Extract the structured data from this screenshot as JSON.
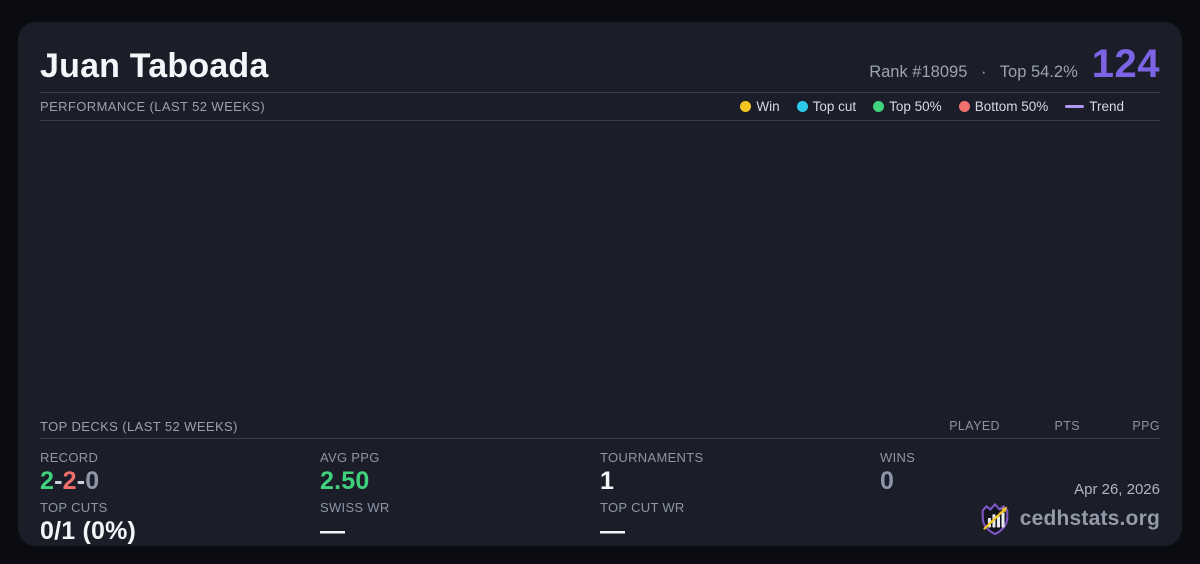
{
  "header": {
    "title": "Juan Taboada",
    "rank_text": "Rank #18095",
    "separator": "·",
    "top_percent_text": "Top 54.2%",
    "points": "124"
  },
  "performance": {
    "label": "PERFORMANCE (LAST 52 WEEKS)",
    "legend": [
      {
        "label": "Win",
        "color": "#f3c622",
        "swatch": "dot"
      },
      {
        "label": "Top cut",
        "color": "#2bc9ea",
        "swatch": "dot"
      },
      {
        "label": "Top 50%",
        "color": "#41d47e",
        "swatch": "dot"
      },
      {
        "label": "Bottom 50%",
        "color": "#f1706d",
        "swatch": "dot"
      },
      {
        "label": "Trend",
        "color": "#b095f2",
        "swatch": "line"
      }
    ]
  },
  "chart_data": {
    "type": "scatter",
    "title": "PERFORMANCE (LAST 52 WEEKS)",
    "series": [],
    "legend_position": "top-right",
    "grid": false
  },
  "top_decks": {
    "label": "TOP DECKS (LAST 52 WEEKS)",
    "columns": [
      "PLAYED",
      "PTS",
      "PPG"
    ],
    "rows": []
  },
  "stats": {
    "record": {
      "label": "RECORD",
      "wins": "2",
      "losses": "2",
      "draws": "0",
      "separator": "-"
    },
    "avg_ppg": {
      "label": "AVG PPG",
      "value": "2.50"
    },
    "tournaments": {
      "label": "TOURNAMENTS",
      "value": "1"
    },
    "wins": {
      "label": "WINS",
      "value": "0"
    },
    "top_cuts": {
      "label": "TOP CUTS",
      "value": "0/1 (0%)"
    },
    "swiss_wr": {
      "label": "SWISS WR",
      "value": "—"
    },
    "top_cut_wr": {
      "label": "TOP CUT WR",
      "value": "—"
    }
  },
  "footer": {
    "date": "Apr 26, 2026",
    "brand": "cedhstats.org",
    "logo_icon": "shield-bar-chart-arrow"
  },
  "colors": {
    "accent_purple": "#7d64e5",
    "trend_purple": "#b095f2",
    "win_yellow": "#f3c622",
    "top_cut_cyan": "#2bc9ea",
    "top50_green": "#41d47e",
    "bottom50_red": "#f1706d",
    "value_green": "#3fd17c",
    "loss_red": "#f0706e",
    "muted_gray": "#8d95a6",
    "card_bg": "#1b1e28",
    "page_bg": "#0b0c11"
  }
}
